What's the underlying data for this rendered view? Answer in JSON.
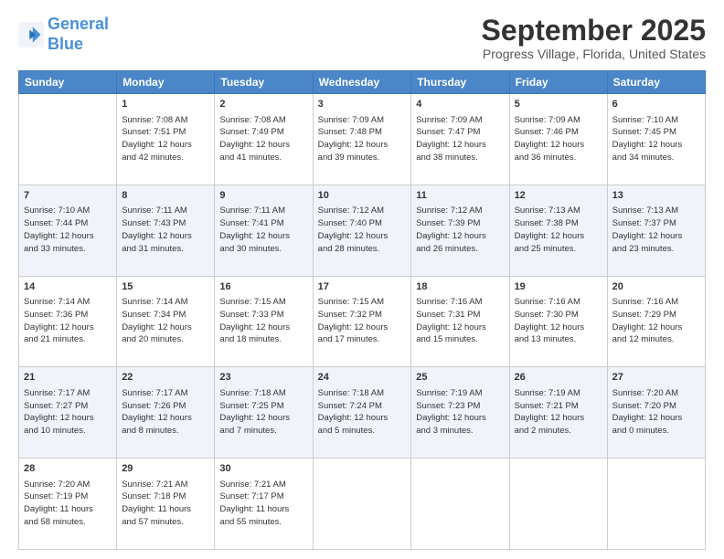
{
  "header": {
    "logo_line1": "General",
    "logo_line2": "Blue",
    "title": "September 2025",
    "subtitle": "Progress Village, Florida, United States"
  },
  "columns": [
    "Sunday",
    "Monday",
    "Tuesday",
    "Wednesday",
    "Thursday",
    "Friday",
    "Saturday"
  ],
  "weeks": [
    [
      {
        "date": "",
        "info": ""
      },
      {
        "date": "1",
        "info": "Sunrise: 7:08 AM\nSunset: 7:51 PM\nDaylight: 12 hours\nand 42 minutes."
      },
      {
        "date": "2",
        "info": "Sunrise: 7:08 AM\nSunset: 7:49 PM\nDaylight: 12 hours\nand 41 minutes."
      },
      {
        "date": "3",
        "info": "Sunrise: 7:09 AM\nSunset: 7:48 PM\nDaylight: 12 hours\nand 39 minutes."
      },
      {
        "date": "4",
        "info": "Sunrise: 7:09 AM\nSunset: 7:47 PM\nDaylight: 12 hours\nand 38 minutes."
      },
      {
        "date": "5",
        "info": "Sunrise: 7:09 AM\nSunset: 7:46 PM\nDaylight: 12 hours\nand 36 minutes."
      },
      {
        "date": "6",
        "info": "Sunrise: 7:10 AM\nSunset: 7:45 PM\nDaylight: 12 hours\nand 34 minutes."
      }
    ],
    [
      {
        "date": "7",
        "info": "Sunrise: 7:10 AM\nSunset: 7:44 PM\nDaylight: 12 hours\nand 33 minutes."
      },
      {
        "date": "8",
        "info": "Sunrise: 7:11 AM\nSunset: 7:43 PM\nDaylight: 12 hours\nand 31 minutes."
      },
      {
        "date": "9",
        "info": "Sunrise: 7:11 AM\nSunset: 7:41 PM\nDaylight: 12 hours\nand 30 minutes."
      },
      {
        "date": "10",
        "info": "Sunrise: 7:12 AM\nSunset: 7:40 PM\nDaylight: 12 hours\nand 28 minutes."
      },
      {
        "date": "11",
        "info": "Sunrise: 7:12 AM\nSunset: 7:39 PM\nDaylight: 12 hours\nand 26 minutes."
      },
      {
        "date": "12",
        "info": "Sunrise: 7:13 AM\nSunset: 7:38 PM\nDaylight: 12 hours\nand 25 minutes."
      },
      {
        "date": "13",
        "info": "Sunrise: 7:13 AM\nSunset: 7:37 PM\nDaylight: 12 hours\nand 23 minutes."
      }
    ],
    [
      {
        "date": "14",
        "info": "Sunrise: 7:14 AM\nSunset: 7:36 PM\nDaylight: 12 hours\nand 21 minutes."
      },
      {
        "date": "15",
        "info": "Sunrise: 7:14 AM\nSunset: 7:34 PM\nDaylight: 12 hours\nand 20 minutes."
      },
      {
        "date": "16",
        "info": "Sunrise: 7:15 AM\nSunset: 7:33 PM\nDaylight: 12 hours\nand 18 minutes."
      },
      {
        "date": "17",
        "info": "Sunrise: 7:15 AM\nSunset: 7:32 PM\nDaylight: 12 hours\nand 17 minutes."
      },
      {
        "date": "18",
        "info": "Sunrise: 7:16 AM\nSunset: 7:31 PM\nDaylight: 12 hours\nand 15 minutes."
      },
      {
        "date": "19",
        "info": "Sunrise: 7:16 AM\nSunset: 7:30 PM\nDaylight: 12 hours\nand 13 minutes."
      },
      {
        "date": "20",
        "info": "Sunrise: 7:16 AM\nSunset: 7:29 PM\nDaylight: 12 hours\nand 12 minutes."
      }
    ],
    [
      {
        "date": "21",
        "info": "Sunrise: 7:17 AM\nSunset: 7:27 PM\nDaylight: 12 hours\nand 10 minutes."
      },
      {
        "date": "22",
        "info": "Sunrise: 7:17 AM\nSunset: 7:26 PM\nDaylight: 12 hours\nand 8 minutes."
      },
      {
        "date": "23",
        "info": "Sunrise: 7:18 AM\nSunset: 7:25 PM\nDaylight: 12 hours\nand 7 minutes."
      },
      {
        "date": "24",
        "info": "Sunrise: 7:18 AM\nSunset: 7:24 PM\nDaylight: 12 hours\nand 5 minutes."
      },
      {
        "date": "25",
        "info": "Sunrise: 7:19 AM\nSunset: 7:23 PM\nDaylight: 12 hours\nand 3 minutes."
      },
      {
        "date": "26",
        "info": "Sunrise: 7:19 AM\nSunset: 7:21 PM\nDaylight: 12 hours\nand 2 minutes."
      },
      {
        "date": "27",
        "info": "Sunrise: 7:20 AM\nSunset: 7:20 PM\nDaylight: 12 hours\nand 0 minutes."
      }
    ],
    [
      {
        "date": "28",
        "info": "Sunrise: 7:20 AM\nSunset: 7:19 PM\nDaylight: 11 hours\nand 58 minutes."
      },
      {
        "date": "29",
        "info": "Sunrise: 7:21 AM\nSunset: 7:18 PM\nDaylight: 11 hours\nand 57 minutes."
      },
      {
        "date": "30",
        "info": "Sunrise: 7:21 AM\nSunset: 7:17 PM\nDaylight: 11 hours\nand 55 minutes."
      },
      {
        "date": "",
        "info": ""
      },
      {
        "date": "",
        "info": ""
      },
      {
        "date": "",
        "info": ""
      },
      {
        "date": "",
        "info": ""
      }
    ]
  ]
}
